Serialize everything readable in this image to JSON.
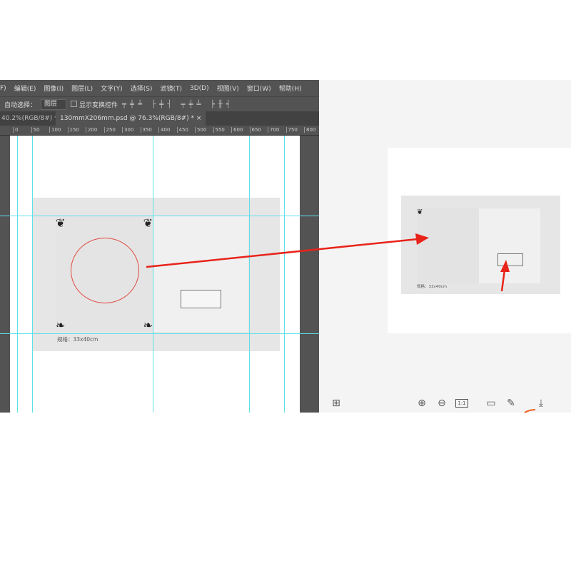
{
  "menu": [
    "F)",
    "编辑(E)",
    "图像(I)",
    "图层(L)",
    "文字(Y)",
    "选择(S)",
    "滤镜(T)",
    "3D(D)",
    "视图(V)",
    "窗口(W)",
    "帮助(H)"
  ],
  "options": {
    "auto_select": "自动选择：",
    "layer_select": "图层",
    "show_transform": "显示变换控件"
  },
  "tabs": [
    {
      "label": "40.2%(RGB/8#) *",
      "close": "×"
    },
    {
      "label": "130mmX206mm.psd @ 76.3%(RGB/8#) *",
      "close": "×"
    }
  ],
  "ruler": [
    "0",
    "50",
    "100",
    "150",
    "200",
    "250",
    "300",
    "350",
    "400",
    "450",
    "500",
    "550",
    "600",
    "650",
    "700",
    "750",
    "800"
  ],
  "doc": {
    "spec": "规格：33x40cm",
    "spec_small": "规格：33x40cm"
  },
  "colors": {
    "guide": "#5ee0e8",
    "arrow": "#e8231a",
    "ps_bg": "#535353"
  }
}
